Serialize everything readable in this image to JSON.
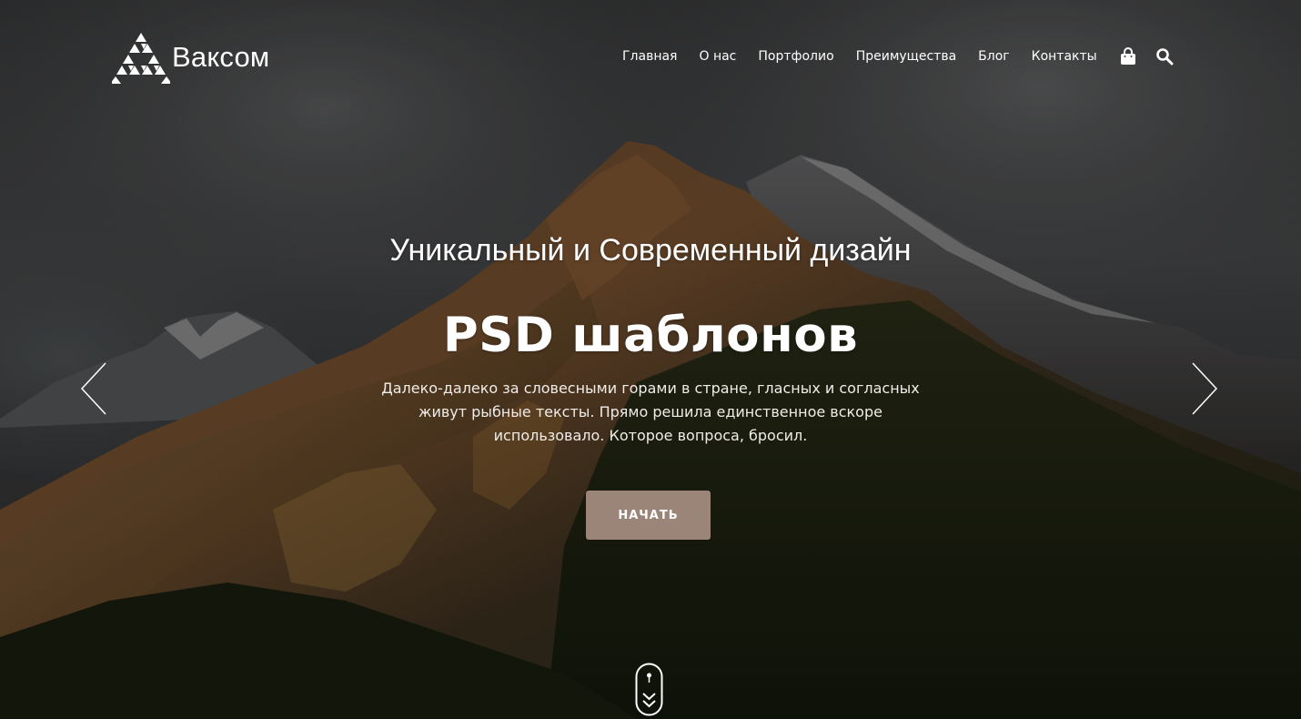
{
  "brand": {
    "name": "Ваксом"
  },
  "nav": {
    "items": [
      {
        "label": "Главная"
      },
      {
        "label": "О нас"
      },
      {
        "label": "Портфолио"
      },
      {
        "label": "Преимущества"
      },
      {
        "label": "Блог"
      },
      {
        "label": "Контакты"
      }
    ],
    "icons": [
      "shopping-bag-icon",
      "search-icon"
    ]
  },
  "hero": {
    "title": "Уникальный и Современный дизайн",
    "heading": "PSD шаблонов",
    "description": "Далеко-далеко за словесными горами в стране, гласных и согласных живут рыбные тексты. Прямо решила единственное вскоре использовало. Которое вопроса, бросил.",
    "cta_label": "НАЧАТЬ"
  },
  "colors": {
    "accent": "#9a8578",
    "text": "#ffffff"
  }
}
